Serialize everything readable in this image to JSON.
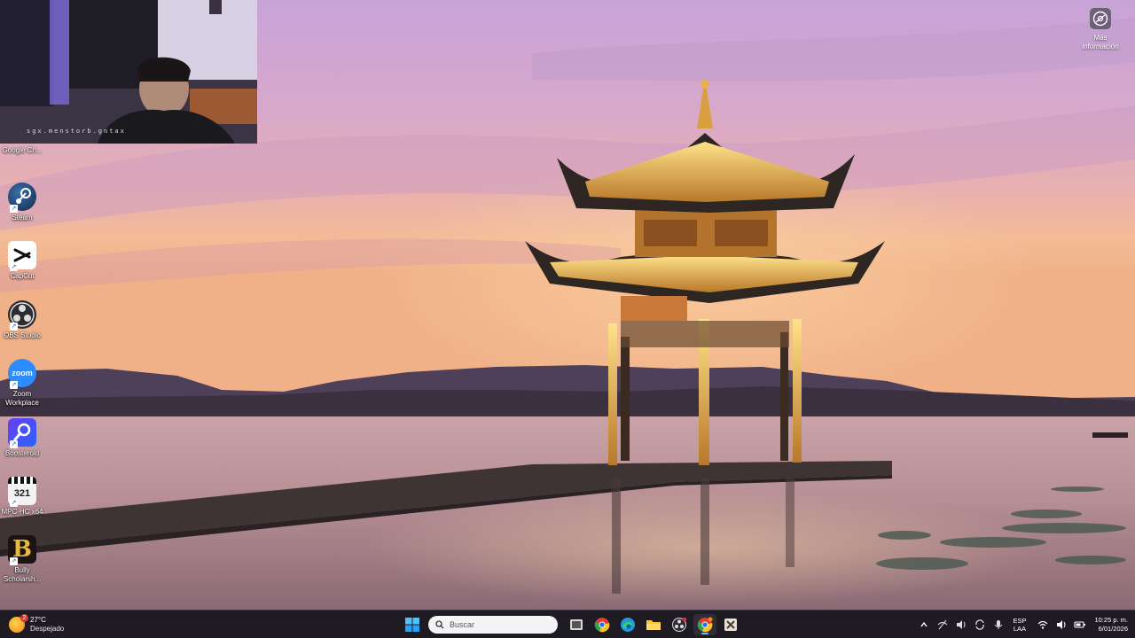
{
  "desktop": {
    "icons": [
      {
        "label": "Google Ch...",
        "icon": "chrome-icon"
      },
      {
        "label": "Steam",
        "icon": "steam-icon"
      },
      {
        "label": "CapCut",
        "icon": "capcut-icon"
      },
      {
        "label": "OBS Studio",
        "icon": "obs-icon"
      },
      {
        "label": "Zoom Workplace",
        "icon": "zoom-icon"
      },
      {
        "label": "Boosteroid",
        "icon": "boosteroid-icon"
      },
      {
        "label": "MPC-HC x64",
        "icon": "mpc-hc-icon"
      },
      {
        "label": "Bully Scholarsh...",
        "icon": "bully-icon"
      }
    ],
    "info_widget": {
      "label": "Más información"
    },
    "zoom_logo_text": "zoom",
    "mpc_logo_text": "321",
    "bully_logo_text": "B"
  },
  "webcam": {
    "caption": "sgx.menstorb.gntax"
  },
  "taskbar": {
    "weather": {
      "temp": "27°C",
      "condition": "Despejado",
      "badge": "2"
    },
    "search": {
      "placeholder": "Buscar"
    },
    "apps": [
      {
        "icon": "windows-start-icon"
      },
      {
        "icon": "task-view-icon"
      },
      {
        "icon": "chrome-icon"
      },
      {
        "icon": "edge-icon"
      },
      {
        "icon": "file-explorer-icon"
      },
      {
        "icon": "obs-icon"
      },
      {
        "icon": "chrome-icon",
        "active": true
      },
      {
        "icon": "video-app-icon"
      }
    ],
    "tray": {
      "lang_line1": "ESP",
      "lang_line2": "LAA",
      "time": "10:25 p. m.",
      "date": "6/01/2026"
    }
  },
  "colors": {
    "taskbar_bg": "#1f1b22",
    "accent": "#60b7ff",
    "zoom_blue": "#2d8cff",
    "sky_top": "#c8a6d6",
    "sky_horizon": "#f2b48a"
  }
}
